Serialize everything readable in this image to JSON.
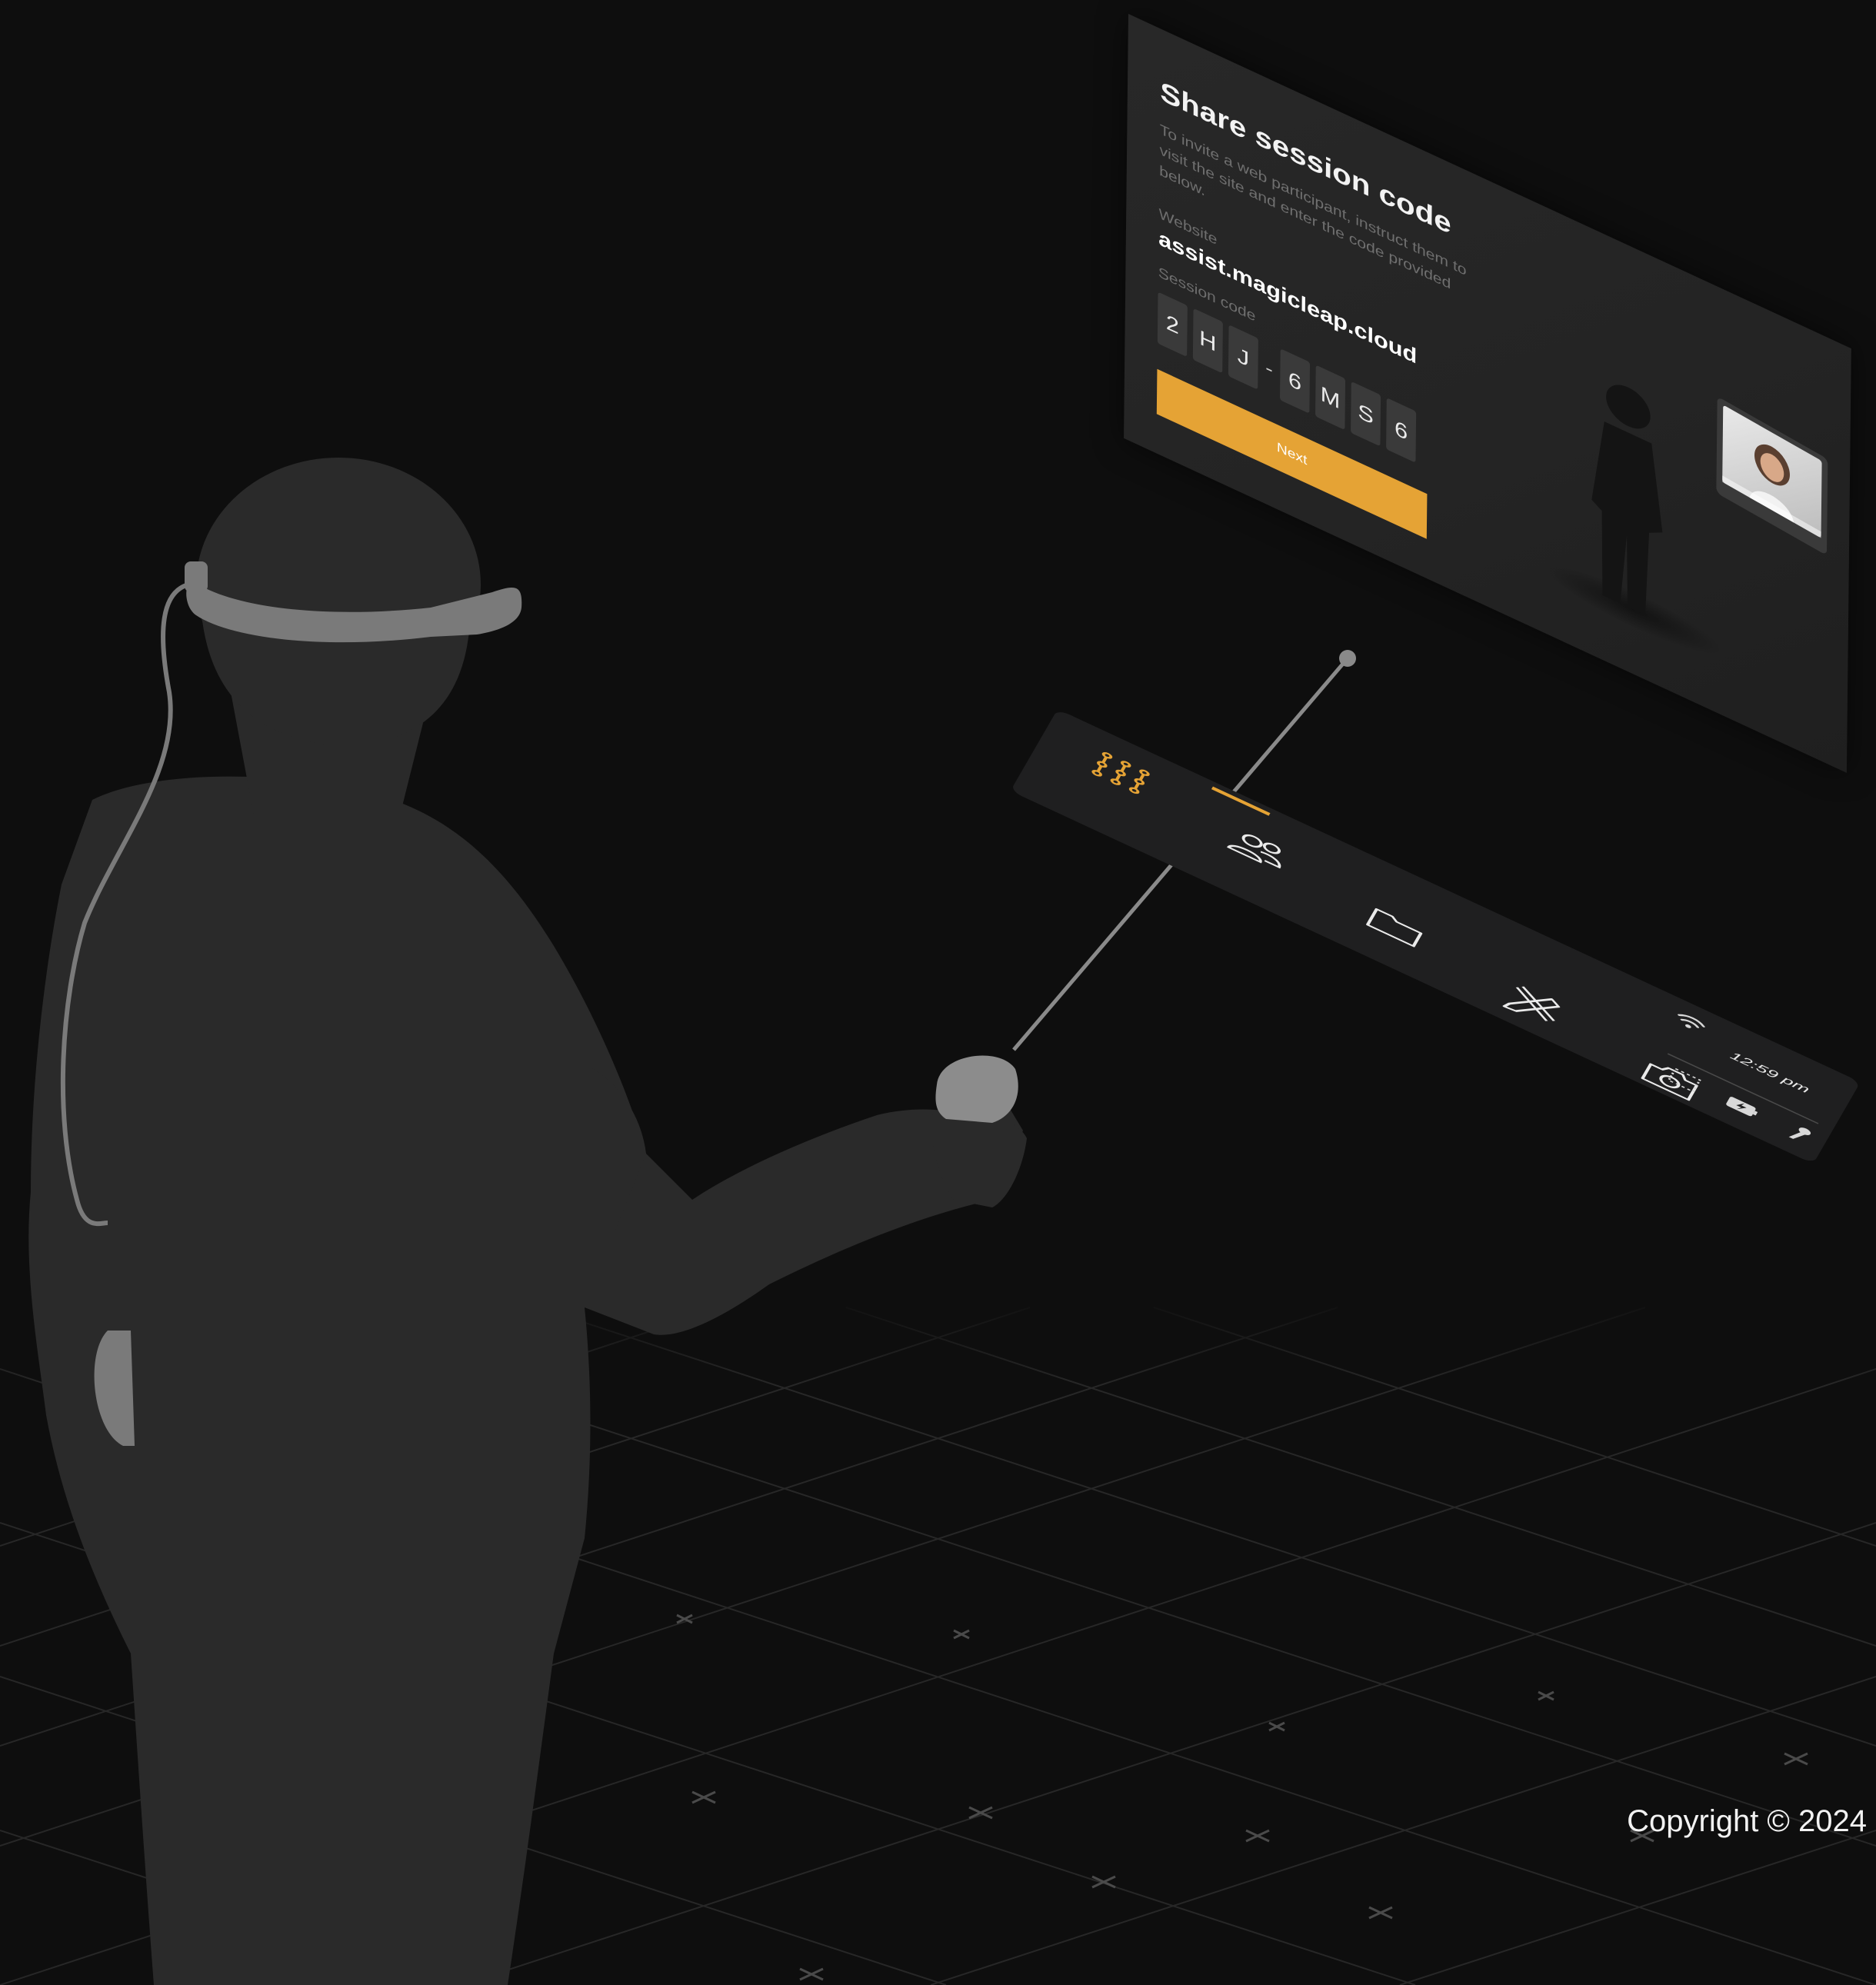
{
  "dialog": {
    "title": "Share session code",
    "description": "To invite a web participant, instruct them to visit the site and enter the code provided below.",
    "website_label": "Website",
    "website_value": "assist.magicleap.cloud",
    "session_code_label": "Session code",
    "session_code_chars": [
      "2",
      "H",
      "J",
      "-",
      "6",
      "M",
      "S",
      "6"
    ],
    "next_label": "Next"
  },
  "toolbar": {
    "active_index": 0,
    "items": [
      {
        "icon": "apps-icon",
        "active": true
      },
      {
        "icon": "people-icon",
        "active": false
      },
      {
        "icon": "folder-icon",
        "active": false
      },
      {
        "icon": "annotation-tools-icon",
        "active": false
      },
      {
        "icon": "camera-icon",
        "active": false
      }
    ],
    "status": {
      "time": "12:59 pm",
      "icons": [
        "wifi-icon",
        "spatial-mapping-icon",
        "battery-charging-icon",
        "controller-icon"
      ]
    }
  },
  "footer": {
    "copyright": "Copyright © 2024"
  },
  "colors": {
    "accent": "#e5a335",
    "background": "#0e0e0e",
    "panel": "#262626",
    "silhouette": "#2a2a2a"
  }
}
